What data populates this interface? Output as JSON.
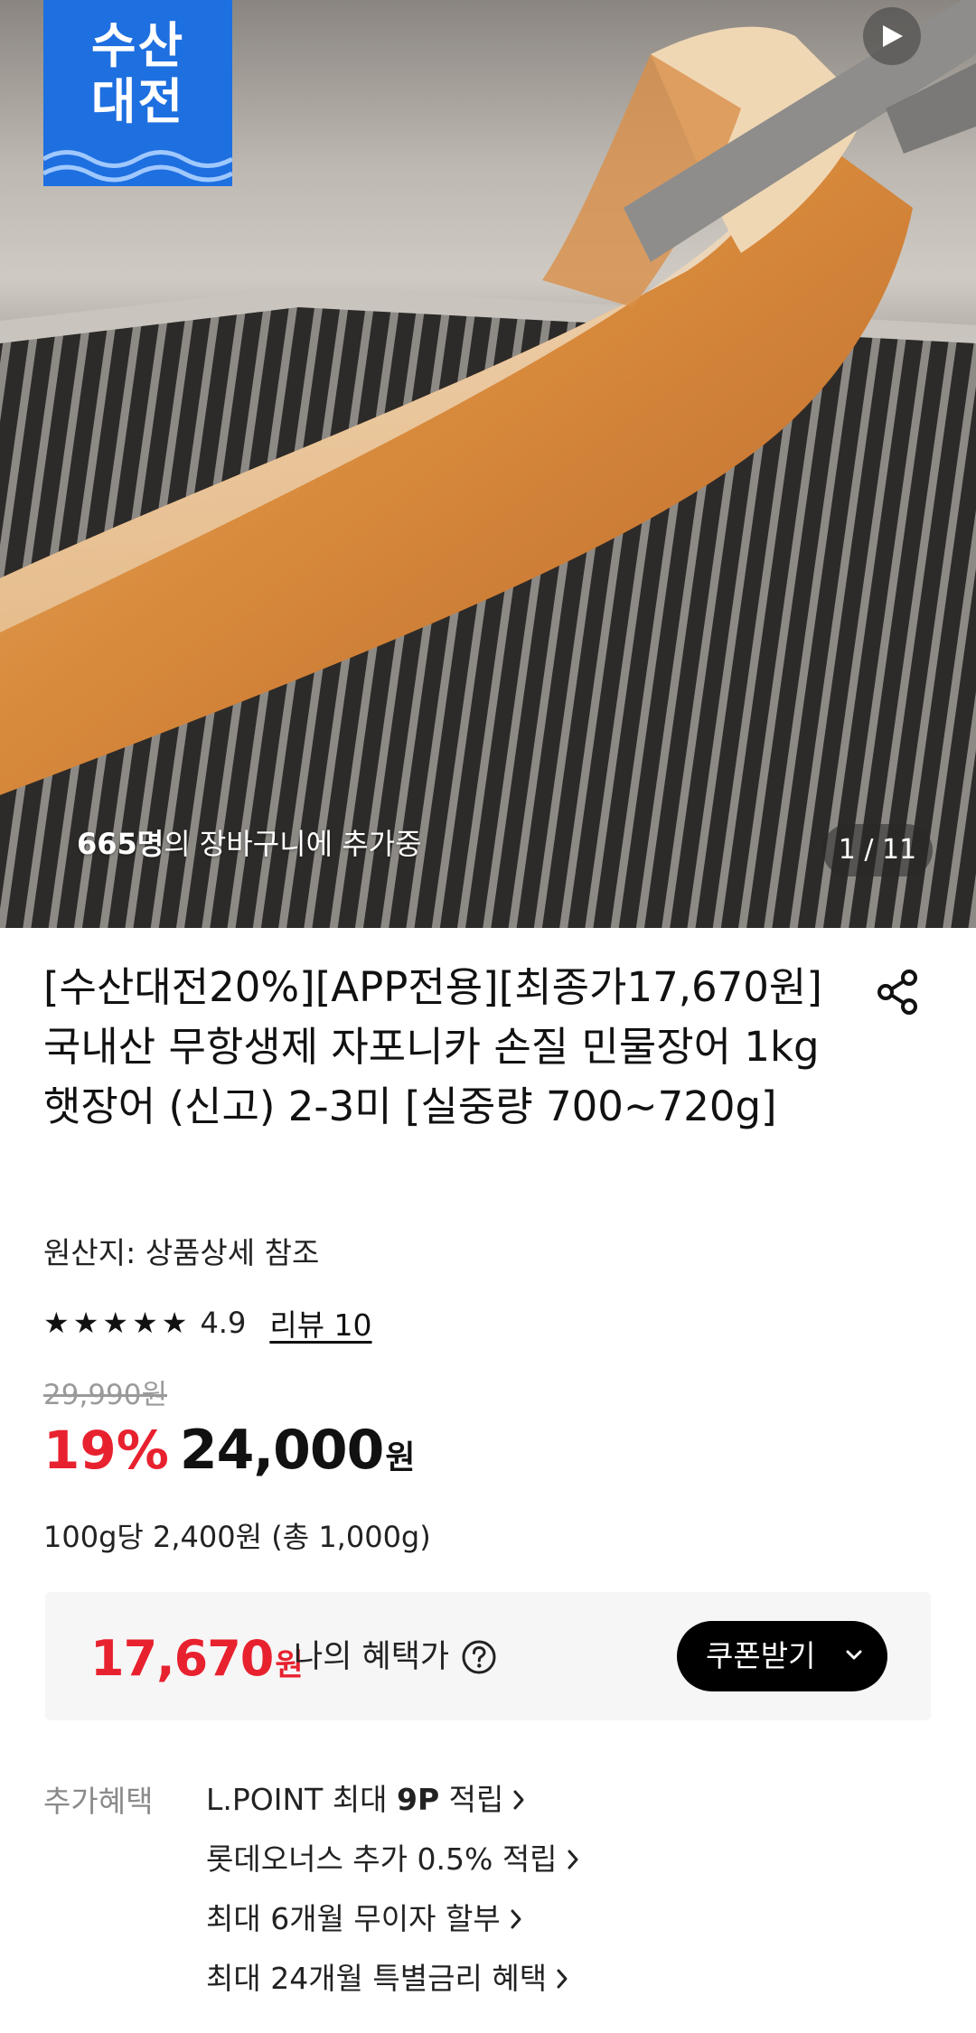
{
  "hero": {
    "badge_text": "수산\n대전",
    "cart_count_number": "665명",
    "cart_count_suffix": "의 장바구니에 추가중",
    "pager": "1 / 11"
  },
  "product": {
    "title": "[수산대전20%][APP전용][최종가17,670원]국내산 무항생제 자포니카 손질 민물장어 1kg 햇장어 (신고) 2-3미 [실중량 700~720g]",
    "origin": "원산지: 상품상세 참조",
    "rating": 4.9,
    "rating_text": "4.9",
    "stars": 5,
    "review_link": "리뷰 10",
    "original_price": "29,990원",
    "discount": "19%",
    "price": "24,000",
    "price_unit": "원",
    "unit_price": "100g당 2,400원 (총 1,000g)"
  },
  "benefit": {
    "price": "17,670",
    "unit": "원",
    "label": "나의 혜택가",
    "coupon_button": "쿠폰받기"
  },
  "extra_benefits": {
    "label": "추가혜택",
    "items": [
      {
        "pre": "L.POINT 최대 ",
        "bold": "9P",
        "post": " 적립"
      },
      {
        "pre": "롯데오너스 추가 0.5% 적립",
        "bold": "",
        "post": ""
      },
      {
        "pre": "최대 6개월 무이자 할부",
        "bold": "",
        "post": ""
      },
      {
        "pre": "최대 24개월 특별금리 혜택",
        "bold": "",
        "post": ""
      }
    ]
  },
  "colors": {
    "accent_red": "#e8212f",
    "badge_blue": "#1e6fe0"
  }
}
